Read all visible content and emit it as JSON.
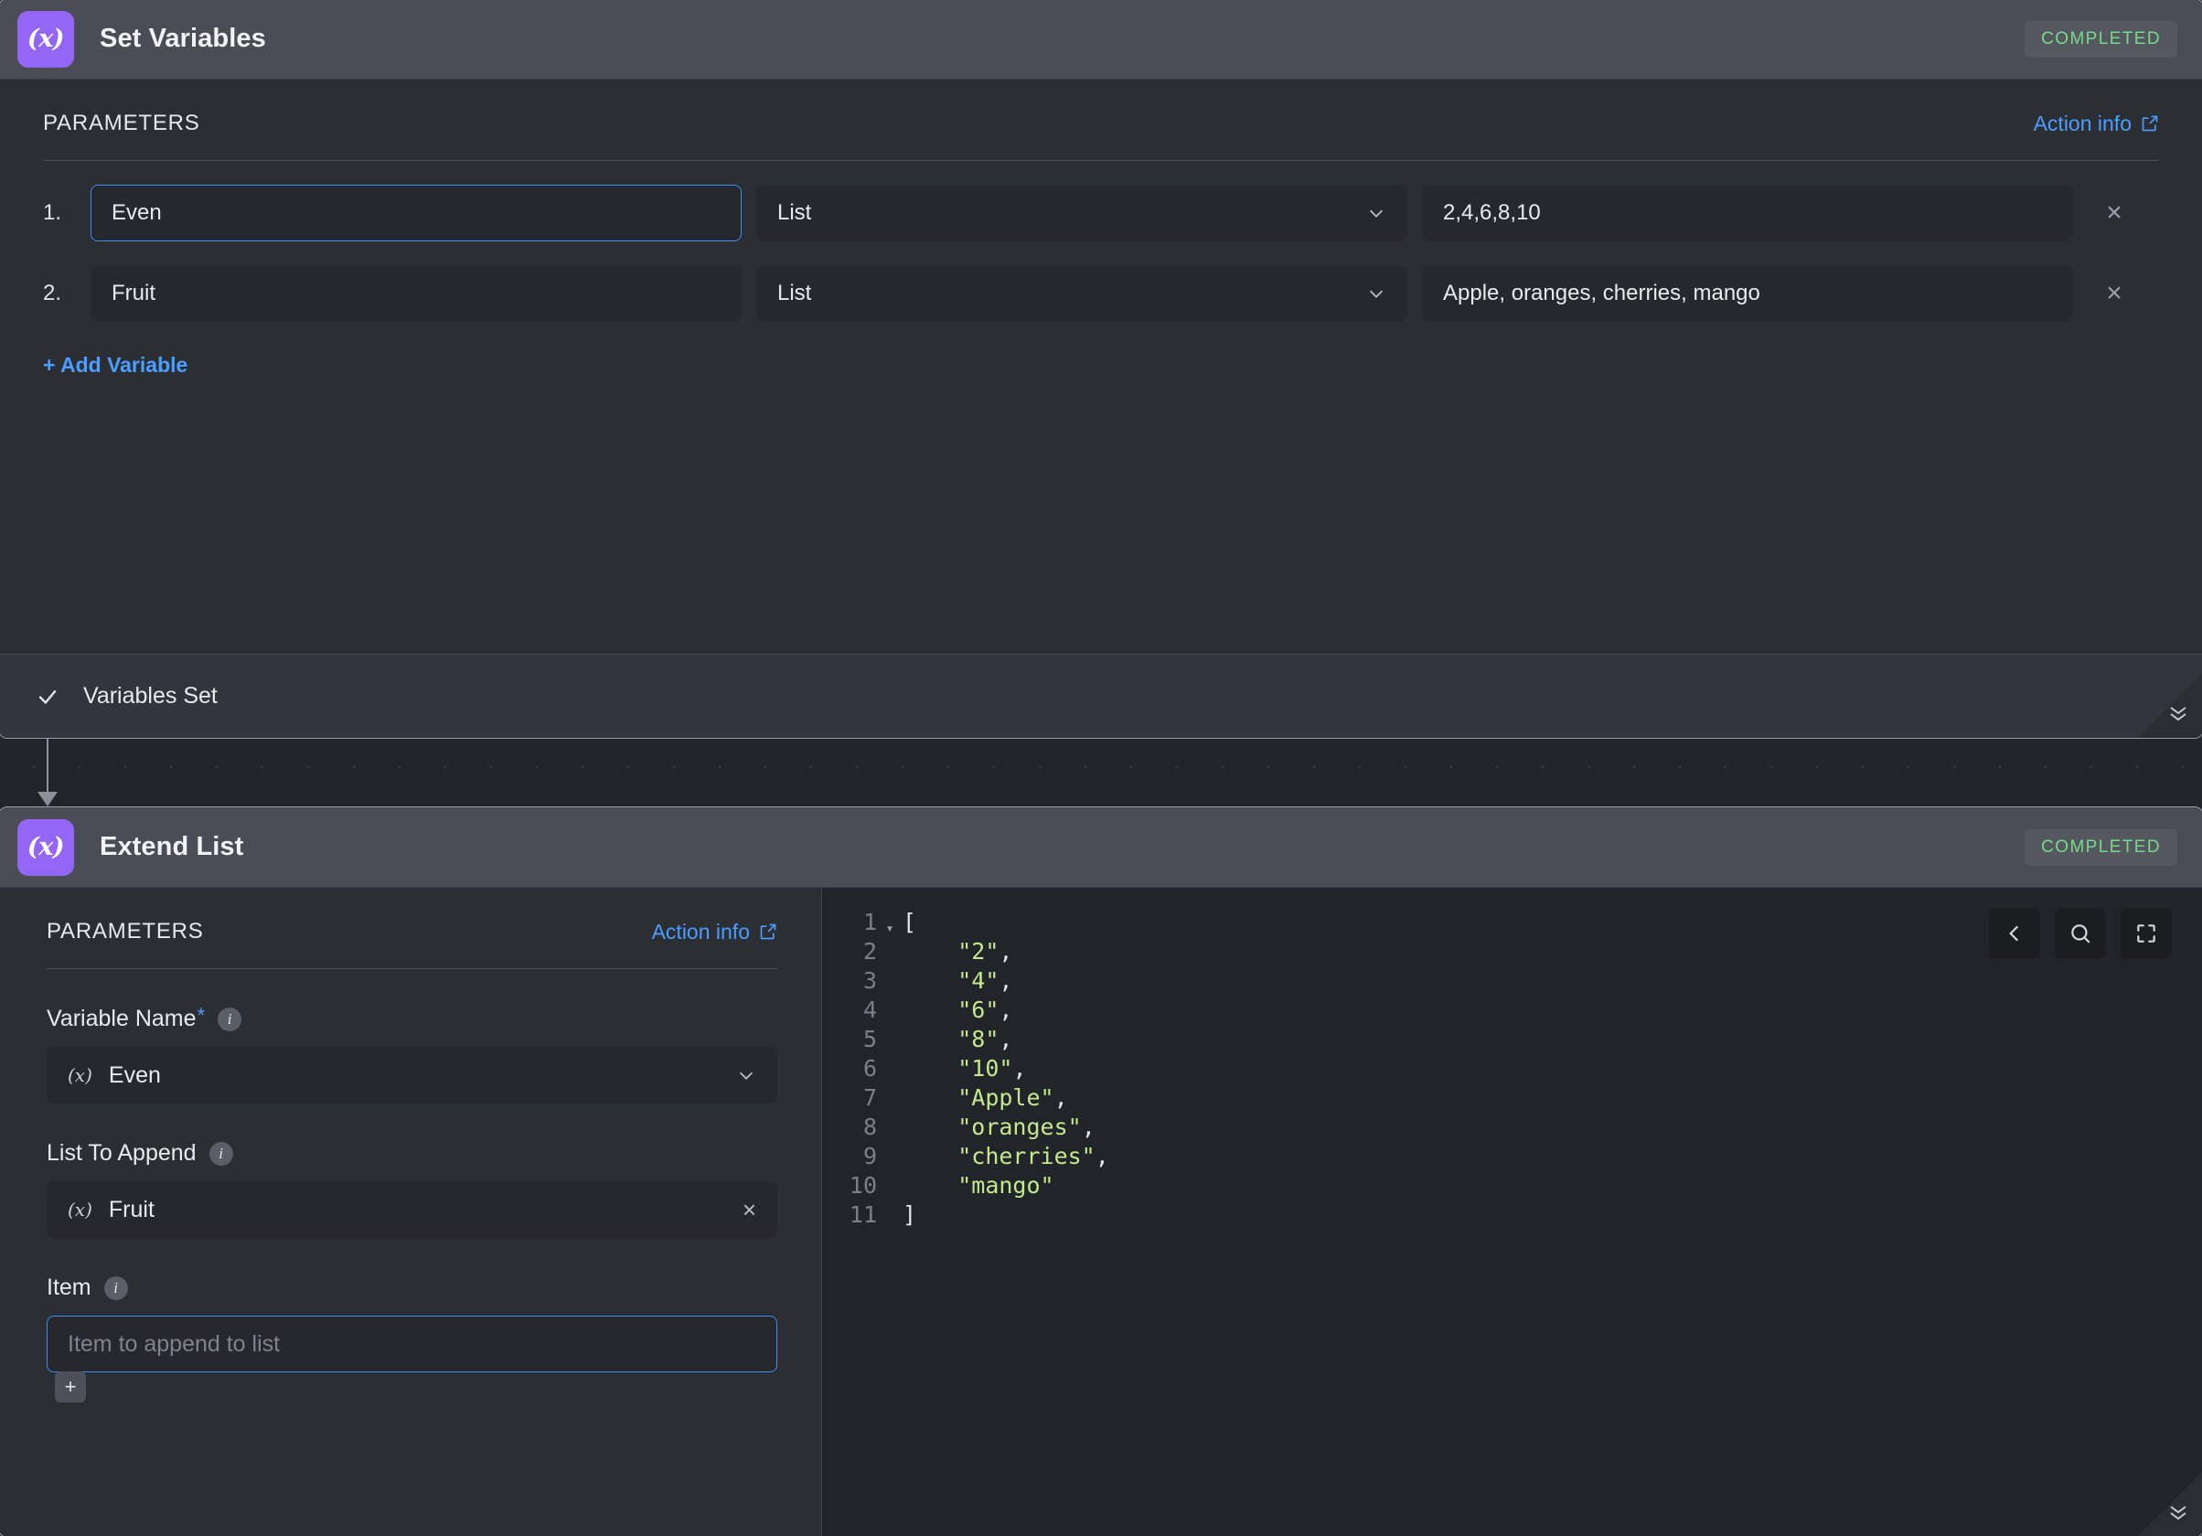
{
  "theme": {
    "accent_blue": "#4a9eff",
    "status_green": "#79d98b",
    "icon_purple": "#9466f5",
    "string_green": "#c3e88d",
    "canvas_bg": "#212428",
    "card_bg": "#2b2e33",
    "header_bg": "#4a4d55"
  },
  "card1": {
    "icon_label": "(x)",
    "icon_name": "variable-icon",
    "title": "Set Variables",
    "status": "COMPLETED",
    "params_label": "PARAMETERS",
    "action_info": "Action info",
    "rows": [
      {
        "num": "1.",
        "name": "Even",
        "type": "List",
        "value": "2,4,6,8,10",
        "remove": "×"
      },
      {
        "num": "2.",
        "name": "Fruit",
        "type": "List",
        "value": "Apple, oranges, cherries, mango",
        "remove": "×"
      }
    ],
    "add_variable": "+ Add Variable",
    "footer_status": "Variables Set",
    "footer_check": "✓"
  },
  "card2": {
    "icon_label": "(x)",
    "icon_name": "variable-icon",
    "title": "Extend List",
    "status": "COMPLETED",
    "params_label": "PARAMETERS",
    "action_info": "Action info",
    "fields": {
      "variable_name": {
        "label": "Variable Name",
        "required_mark": "*",
        "chip": "(x)",
        "value": "Even"
      },
      "list_to_append": {
        "label": "List To Append",
        "chip": "(x)",
        "value": "Fruit",
        "clear": "×"
      },
      "item": {
        "label": "Item",
        "placeholder": "Item to append to list",
        "value": "",
        "add_button": "+"
      }
    },
    "code": {
      "lines": [
        {
          "n": "1",
          "fold": "▾",
          "text": "["
        },
        {
          "n": "2",
          "fold": "",
          "text": "    \"2\","
        },
        {
          "n": "3",
          "fold": "",
          "text": "    \"4\","
        },
        {
          "n": "4",
          "fold": "",
          "text": "    \"6\","
        },
        {
          "n": "5",
          "fold": "",
          "text": "    \"8\","
        },
        {
          "n": "6",
          "fold": "",
          "text": "    \"10\","
        },
        {
          "n": "7",
          "fold": "",
          "text": "    \"Apple\","
        },
        {
          "n": "8",
          "fold": "",
          "text": "    \"oranges\","
        },
        {
          "n": "9",
          "fold": "",
          "text": "    \"cherries\","
        },
        {
          "n": "10",
          "fold": "",
          "text": "    \"mango\""
        },
        {
          "n": "11",
          "fold": "",
          "text": "]"
        }
      ],
      "toolbar": [
        {
          "name": "collapse-left-icon"
        },
        {
          "name": "search-icon"
        },
        {
          "name": "fullscreen-icon"
        }
      ]
    }
  }
}
